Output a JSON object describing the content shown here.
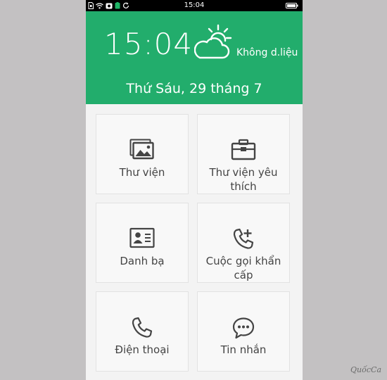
{
  "status_bar": {
    "time": "15:04"
  },
  "header": {
    "clock": "15:04",
    "weather_text": "Không d.liệu",
    "date": "Thứ Sáu, 29 tháng 7",
    "accent_color": "#22ad6c"
  },
  "tiles": [
    {
      "label": "Thư viện",
      "icon": "gallery-icon"
    },
    {
      "label": "Thư viện yêu thích",
      "icon": "briefcase-icon"
    },
    {
      "label": "Danh bạ",
      "icon": "contact-card-icon"
    },
    {
      "label": "Cuộc gọi khẩn cấp",
      "icon": "phone-plus-icon"
    },
    {
      "label": "Điện thoại",
      "icon": "phone-icon"
    },
    {
      "label": "Tin nhắn",
      "icon": "chat-bubble-icon"
    }
  ],
  "watermark": "QuốcCa"
}
